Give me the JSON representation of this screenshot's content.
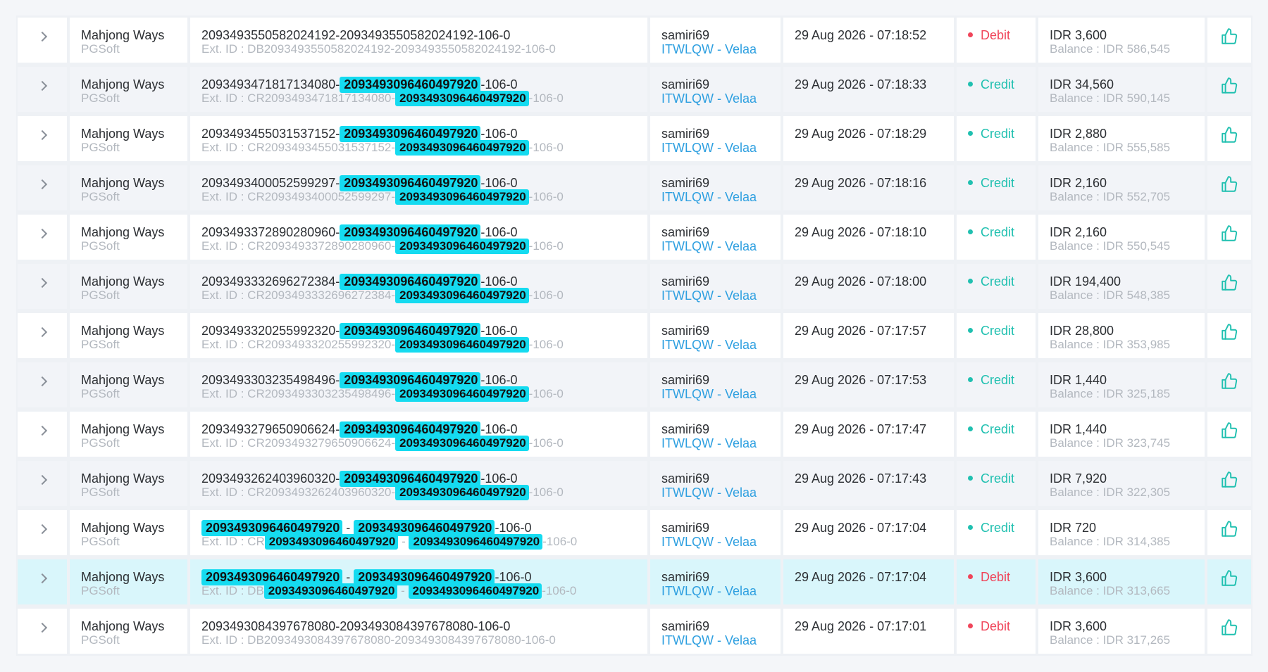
{
  "rows": [
    {
      "game": "Mahjong Ways",
      "provider": "PGSoft",
      "id_segments": [
        {
          "t": "209349355058202419​2-2093493550582024192-106-0",
          "hl": false
        }
      ],
      "ext_segments": [
        {
          "t": "Ext. ID : DB2093493550582024192-2093493550582024192-106-0",
          "hl": false
        }
      ],
      "user": "samiri69",
      "agent": "ITWLQW - Velaa",
      "datetime": "29 Aug 2026 - 07:18:52",
      "type": "Debit",
      "amount": "IDR 3,600",
      "balance": "Balance : IDR 586,545"
    },
    {
      "game": "Mahjong Ways",
      "provider": "PGSoft",
      "id_segments": [
        {
          "t": "2093493471817134080-",
          "hl": false
        },
        {
          "t": "2093493096460497920",
          "hl": true
        },
        {
          "t": "-106-0",
          "hl": false
        }
      ],
      "ext_segments": [
        {
          "t": "Ext. ID : CR2093493471817134080-",
          "hl": false
        },
        {
          "t": "2093493096460497920",
          "hl": true
        },
        {
          "t": "-106-0",
          "hl": false
        }
      ],
      "user": "samiri69",
      "agent": "ITWLQW - Velaa",
      "datetime": "29 Aug 2026 - 07:18:33",
      "type": "Credit",
      "amount": "IDR 34,560",
      "balance": "Balance : IDR 590,145"
    },
    {
      "game": "Mahjong Ways",
      "provider": "PGSoft",
      "id_segments": [
        {
          "t": "2093493455031537152-",
          "hl": false
        },
        {
          "t": "2093493096460497920",
          "hl": true
        },
        {
          "t": "-106-0",
          "hl": false
        }
      ],
      "ext_segments": [
        {
          "t": "Ext. ID : CR2093493455031537152-",
          "hl": false
        },
        {
          "t": "2093493096460497920",
          "hl": true
        },
        {
          "t": "-106-0",
          "hl": false
        }
      ],
      "user": "samiri69",
      "agent": "ITWLQW - Velaa",
      "datetime": "29 Aug 2026 - 07:18:29",
      "type": "Credit",
      "amount": "IDR 2,880",
      "balance": "Balance : IDR 555,585"
    },
    {
      "game": "Mahjong Ways",
      "provider": "PGSoft",
      "id_segments": [
        {
          "t": "2093493400052599297-",
          "hl": false
        },
        {
          "t": "2093493096460497920",
          "hl": true
        },
        {
          "t": "-106-0",
          "hl": false
        }
      ],
      "ext_segments": [
        {
          "t": "Ext. ID : CR2093493400052599297-",
          "hl": false
        },
        {
          "t": "2093493096460497920",
          "hl": true
        },
        {
          "t": "-106-0",
          "hl": false
        }
      ],
      "user": "samiri69",
      "agent": "ITWLQW - Velaa",
      "datetime": "29 Aug 2026 - 07:18:16",
      "type": "Credit",
      "amount": "IDR 2,160",
      "balance": "Balance : IDR 552,705"
    },
    {
      "game": "Mahjong Ways",
      "provider": "PGSoft",
      "id_segments": [
        {
          "t": "2093493372890280960-",
          "hl": false
        },
        {
          "t": "2093493096460497920",
          "hl": true
        },
        {
          "t": "-106-0",
          "hl": false
        }
      ],
      "ext_segments": [
        {
          "t": "Ext. ID : CR2093493372890280960-",
          "hl": false
        },
        {
          "t": "2093493096460497920",
          "hl": true
        },
        {
          "t": "-106-0",
          "hl": false
        }
      ],
      "user": "samiri69",
      "agent": "ITWLQW - Velaa",
      "datetime": "29 Aug 2026 - 07:18:10",
      "type": "Credit",
      "amount": "IDR 2,160",
      "balance": "Balance : IDR 550,545"
    },
    {
      "game": "Mahjong Ways",
      "provider": "PGSoft",
      "id_segments": [
        {
          "t": "2093493332696272384-",
          "hl": false
        },
        {
          "t": "2093493096460497920",
          "hl": true
        },
        {
          "t": "-106-0",
          "hl": false
        }
      ],
      "ext_segments": [
        {
          "t": "Ext. ID : CR2093493332696272384-",
          "hl": false
        },
        {
          "t": "2093493096460497920",
          "hl": true
        },
        {
          "t": "-106-0",
          "hl": false
        }
      ],
      "user": "samiri69",
      "agent": "ITWLQW - Velaa",
      "datetime": "29 Aug 2026 - 07:18:00",
      "type": "Credit",
      "amount": "IDR 194,400",
      "balance": "Balance : IDR 548,385"
    },
    {
      "game": "Mahjong Ways",
      "provider": "PGSoft",
      "id_segments": [
        {
          "t": "2093493320255992320-",
          "hl": false
        },
        {
          "t": "2093493096460497920",
          "hl": true
        },
        {
          "t": "-106-0",
          "hl": false
        }
      ],
      "ext_segments": [
        {
          "t": "Ext. ID : CR2093493320255992320-",
          "hl": false
        },
        {
          "t": "2093493096460497920",
          "hl": true
        },
        {
          "t": "-106-0",
          "hl": false
        }
      ],
      "user": "samiri69",
      "agent": "ITWLQW - Velaa",
      "datetime": "29 Aug 2026 - 07:17:57",
      "type": "Credit",
      "amount": "IDR 28,800",
      "balance": "Balance : IDR 353,985"
    },
    {
      "game": "Mahjong Ways",
      "provider": "PGSoft",
      "id_segments": [
        {
          "t": "2093493303235498496-",
          "hl": false
        },
        {
          "t": "2093493096460497920",
          "hl": true
        },
        {
          "t": "-106-0",
          "hl": false
        }
      ],
      "ext_segments": [
        {
          "t": "Ext. ID : CR2093493303235498496-",
          "hl": false
        },
        {
          "t": "2093493096460497920",
          "hl": true
        },
        {
          "t": "-106-0",
          "hl": false
        }
      ],
      "user": "samiri69",
      "agent": "ITWLQW - Velaa",
      "datetime": "29 Aug 2026 - 07:17:53",
      "type": "Credit",
      "amount": "IDR 1,440",
      "balance": "Balance : IDR 325,185"
    },
    {
      "game": "Mahjong Ways",
      "provider": "PGSoft",
      "id_segments": [
        {
          "t": "2093493279650906624-",
          "hl": false
        },
        {
          "t": "2093493096460497920",
          "hl": true
        },
        {
          "t": "-106-0",
          "hl": false
        }
      ],
      "ext_segments": [
        {
          "t": "Ext. ID : CR2093493279650906624-",
          "hl": false
        },
        {
          "t": "2093493096460497920",
          "hl": true
        },
        {
          "t": "-106-0",
          "hl": false
        }
      ],
      "user": "samiri69",
      "agent": "ITWLQW - Velaa",
      "datetime": "29 Aug 2026 - 07:17:47",
      "type": "Credit",
      "amount": "IDR 1,440",
      "balance": "Balance : IDR 323,745"
    },
    {
      "game": "Mahjong Ways",
      "provider": "PGSoft",
      "id_segments": [
        {
          "t": "2093493262403960320-",
          "hl": false
        },
        {
          "t": "2093493096460497920",
          "hl": true
        },
        {
          "t": "-106-0",
          "hl": false
        }
      ],
      "ext_segments": [
        {
          "t": "Ext. ID : CR2093493262403960320-",
          "hl": false
        },
        {
          "t": "2093493096460497920",
          "hl": true
        },
        {
          "t": "-106-0",
          "hl": false
        }
      ],
      "user": "samiri69",
      "agent": "ITWLQW - Velaa",
      "datetime": "29 Aug 2026 - 07:17:43",
      "type": "Credit",
      "amount": "IDR 7,920",
      "balance": "Balance : IDR 322,305"
    },
    {
      "game": "Mahjong Ways",
      "provider": "PGSoft",
      "id_segments": [
        {
          "t": "2093493096460497920",
          "hl": true
        },
        {
          "t": " - ",
          "hl": false
        },
        {
          "t": "2093493096460497920",
          "hl": true
        },
        {
          "t": "-106-0",
          "hl": false
        }
      ],
      "ext_segments": [
        {
          "t": "Ext. ID : CR",
          "hl": false
        },
        {
          "t": "2093493096460497920",
          "hl": true
        },
        {
          "t": " - ",
          "hl": false
        },
        {
          "t": "2093493096460497920",
          "hl": true
        },
        {
          "t": "-106-0",
          "hl": false
        }
      ],
      "user": "samiri69",
      "agent": "ITWLQW - Velaa",
      "datetime": "29 Aug 2026 - 07:17:04",
      "type": "Credit",
      "amount": "IDR 720",
      "balance": "Balance : IDR 314,385"
    },
    {
      "game": "Mahjong Ways",
      "provider": "PGSoft",
      "id_segments": [
        {
          "t": "2093493096460497920",
          "hl": true
        },
        {
          "t": " - ",
          "hl": false
        },
        {
          "t": "2093493096460497920",
          "hl": true
        },
        {
          "t": "-106-0",
          "hl": false
        }
      ],
      "ext_segments": [
        {
          "t": "Ext. ID : DB",
          "hl": false
        },
        {
          "t": "2093493096460497920",
          "hl": true
        },
        {
          "t": " - ",
          "hl": false
        },
        {
          "t": "2093493096460497920",
          "hl": true
        },
        {
          "t": "-106-0",
          "hl": false
        }
      ],
      "user": "samiri69",
      "agent": "ITWLQW - Velaa",
      "datetime": "29 Aug 2026 - 07:17:04",
      "type": "Debit",
      "amount": "IDR 3,600",
      "balance": "Balance : IDR 313,665",
      "highlighted": true
    },
    {
      "game": "Mahjong Ways",
      "provider": "PGSoft",
      "id_segments": [
        {
          "t": "2093493084397678080-2093493084397678080-106-0",
          "hl": false
        }
      ],
      "ext_segments": [
        {
          "t": "Ext. ID : DB2093493084397678080-2093493084397678080-106-0",
          "hl": false
        }
      ],
      "user": "samiri69",
      "agent": "ITWLQW - Velaa",
      "datetime": "29 Aug 2026 - 07:17:01",
      "type": "Debit",
      "amount": "IDR 3,600",
      "balance": "Balance : IDR 317,265"
    }
  ],
  "icons": {
    "expand": "chevron-right-icon",
    "action": "thumbs-up-icon",
    "type_dot": "status-dot-icon"
  },
  "colors": {
    "debit": "#f0455a",
    "credit": "#20c0b0",
    "link": "#2d9fe0",
    "highlight": "#15dbf0",
    "selected_row": "#d9f6fb"
  }
}
